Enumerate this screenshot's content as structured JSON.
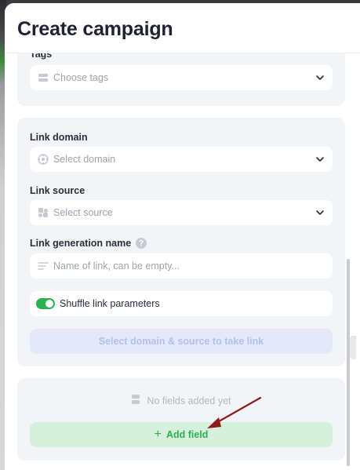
{
  "modal": {
    "title": "Create campaign"
  },
  "tags": {
    "label": "Tags",
    "placeholder": "Choose tags"
  },
  "link": {
    "domain": {
      "label": "Link domain",
      "placeholder": "Select domain"
    },
    "source": {
      "label": "Link source",
      "placeholder": "Select source"
    },
    "generation_name": {
      "label": "Link generation name",
      "placeholder": "Name of link, can be empty..."
    },
    "shuffle": {
      "label": "Shuffle link parameters",
      "enabled": true
    },
    "take_link_button": "Select domain & source to take link"
  },
  "fields": {
    "empty_text": "No fields added yet",
    "add_button": "Add field"
  },
  "colors": {
    "accent_green": "#2bb24c",
    "disabled_blue": "#b2c1e4",
    "annotation_arrow": "#8b1a1a"
  }
}
